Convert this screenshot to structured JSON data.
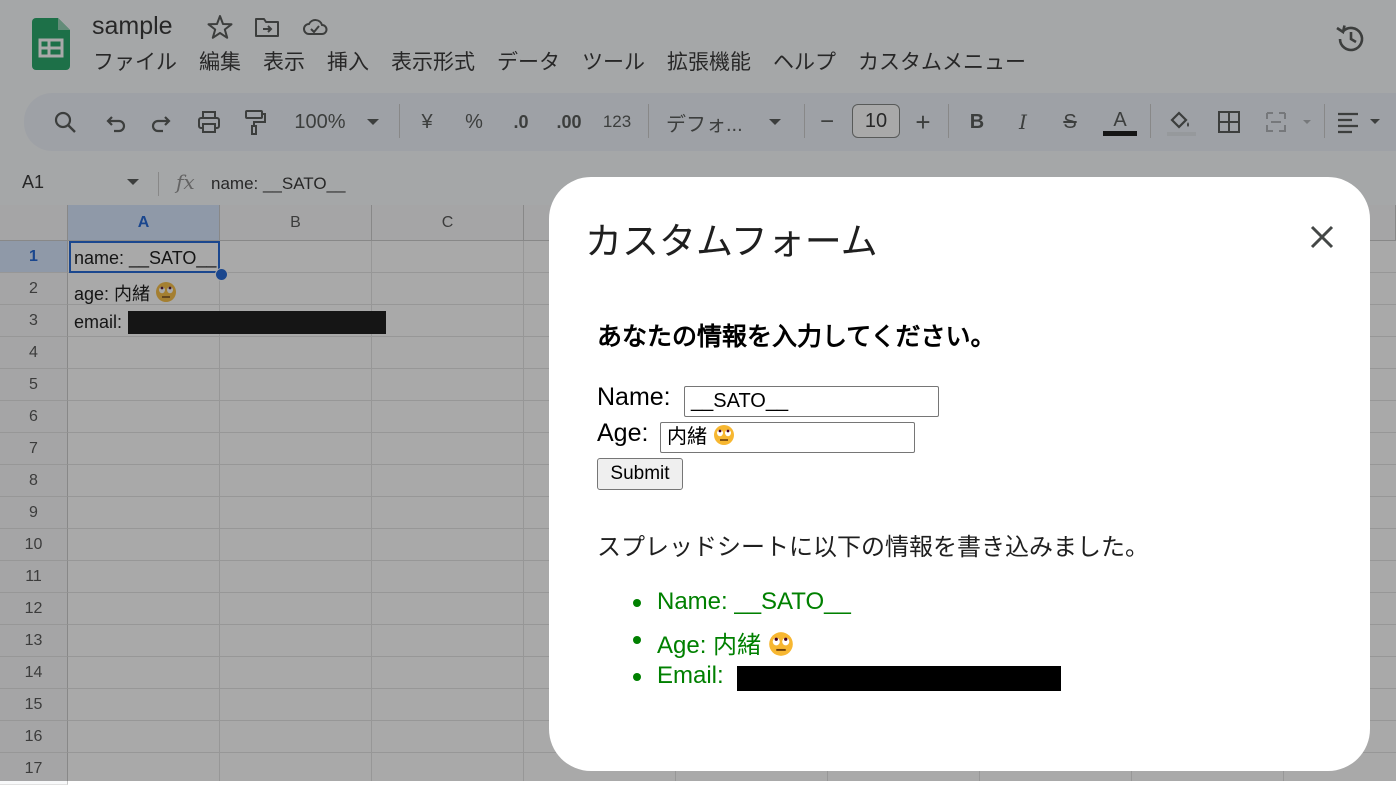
{
  "app": {
    "doc_title": "sample",
    "menu": [
      "ファイル",
      "編集",
      "表示",
      "挿入",
      "表示形式",
      "データ",
      "ツール",
      "拡張機能",
      "ヘルプ",
      "カスタムメニュー"
    ]
  },
  "toolbar": {
    "zoom": "100%",
    "currency": "¥",
    "percent": "%",
    "dec_decrease": ".0",
    "dec_increase": ".00",
    "number_format": "123",
    "font": "デフォ...",
    "font_size": "10",
    "minus": "−",
    "plus": "+",
    "bold": "B",
    "italic": "I",
    "strike": "S",
    "text_color_label": "A",
    "text_color": "#000000"
  },
  "formula_bar": {
    "cell_ref": "A1",
    "fx": "fx",
    "content": "name: __SATO__"
  },
  "grid": {
    "columns": [
      "A",
      "B",
      "C"
    ],
    "rows": [
      "1",
      "2",
      "3",
      "4",
      "5",
      "6",
      "7",
      "8",
      "9",
      "10",
      "11",
      "12",
      "13",
      "14",
      "15",
      "16",
      "17"
    ],
    "cells": {
      "a1": "name: __SATO__",
      "a2": "age: 内緒",
      "a3": "email:"
    },
    "selected_cell": "A1"
  },
  "dialog": {
    "title": "カスタムフォーム",
    "heading": "あなたの情報を入力してください。",
    "name_label": "Name:",
    "name_value": "__SATO__",
    "age_label": "Age:",
    "age_value": "内緒",
    "submit_label": "Submit",
    "result_text": "スプレッドシートに以下の情報を書き込みました。",
    "results": {
      "name": "Name: __SATO__",
      "age": "Age: 内緒",
      "email": "Email:"
    },
    "result_color": "#008000"
  }
}
